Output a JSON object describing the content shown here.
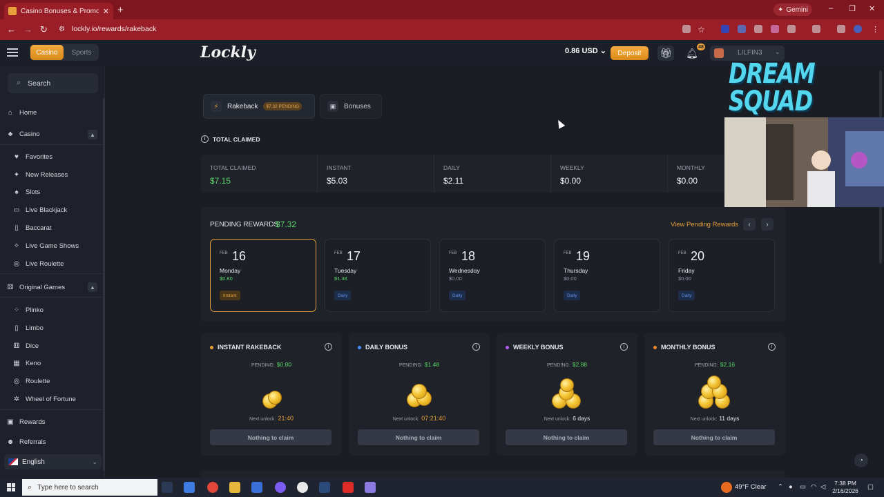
{
  "browser": {
    "tab_title": "Casino Bonuses & Promotio",
    "new_tab": "+",
    "gemini": "Gemini",
    "url": "lockly.io/rewards/rakeback",
    "window_controls": [
      "–",
      "❐",
      "✕"
    ]
  },
  "header": {
    "casino": "Casino",
    "sports": "Sports",
    "logo": "Lockly",
    "balance": "0.86 USD",
    "deposit": "Deposit",
    "notifications": "48",
    "username": "LILFIN3"
  },
  "sidebar": {
    "search_placeholder": "Search",
    "home": "Home",
    "casino": "Casino",
    "casino_items": [
      "Favorites",
      "New Releases",
      "Slots",
      "Live Blackjack",
      "Baccarat",
      "Live Game Shows",
      "Live Roulette"
    ],
    "original_games": "Original Games",
    "original_items": [
      "Plinko",
      "Limbo",
      "Dice",
      "Keno",
      "Roulette",
      "Wheel of Fortune"
    ],
    "rewards": "Rewards",
    "referrals": "Referrals",
    "language": "English"
  },
  "tabs": {
    "rakeback": "Rakeback",
    "rakeback_pending": "$7.32 PENDING",
    "bonuses": "Bonuses"
  },
  "totals": {
    "heading": "TOTAL CLAIMED",
    "items": [
      {
        "label": "TOTAL CLAIMED",
        "value": "$7.15"
      },
      {
        "label": "INSTANT",
        "value": "$5.03"
      },
      {
        "label": "DAILY",
        "value": "$2.11"
      },
      {
        "label": "WEEKLY",
        "value": "$0.00"
      },
      {
        "label": "MONTHLY",
        "value": "$0.00"
      }
    ]
  },
  "pending": {
    "title": "PENDING REWARDS:",
    "amount": "$7.32",
    "view_link": "View Pending Rewards",
    "days": [
      {
        "month": "FEB",
        "day": "16",
        "weekday": "Monday",
        "amount": "$0.80",
        "tag": "Instant"
      },
      {
        "month": "FEB",
        "day": "17",
        "weekday": "Tuesday",
        "amount": "$1.48",
        "tag": "Daily"
      },
      {
        "month": "FEB",
        "day": "18",
        "weekday": "Wednesday",
        "amount": "$0.00",
        "tag": "Daily"
      },
      {
        "month": "FEB",
        "day": "19",
        "weekday": "Thursday",
        "amount": "$0.00",
        "tag": "Daily"
      },
      {
        "month": "FEB",
        "day": "20",
        "weekday": "Friday",
        "amount": "$0.00",
        "tag": "Daily"
      }
    ]
  },
  "bonuses": [
    {
      "title": "INSTANT RAKEBACK",
      "pending_label": "PENDING:",
      "pending": "$0.80",
      "unlock_label": "Next unlock:",
      "unlock": "21:40",
      "button": "Nothing to claim",
      "color": "#e8a13a"
    },
    {
      "title": "DAILY BONUS",
      "pending_label": "PENDING:",
      "pending": "$1.48",
      "unlock_label": "Next unlock:",
      "unlock": "07:21:40",
      "button": "Nothing to claim",
      "color": "#4c8dff"
    },
    {
      "title": "WEEKLY BONUS",
      "pending_label": "PENDING:",
      "pending": "$2.88",
      "unlock_label": "Next unlock:",
      "unlock": "6 days",
      "button": "Nothing to claim",
      "color": "#b15cf0"
    },
    {
      "title": "MONTHLY BONUS",
      "pending_label": "PENDING:",
      "pending": "$2.16",
      "unlock_label": "Next unlock:",
      "unlock": "11 days",
      "button": "Nothing to claim",
      "color": "#f08a2a"
    }
  ],
  "overlay": {
    "stream_title": "DREAM SQUAD"
  },
  "taskbar": {
    "search_placeholder": "Type here to search",
    "weather": "49°F  Clear",
    "time": "7:38 PM",
    "date": "2/16/2026"
  }
}
